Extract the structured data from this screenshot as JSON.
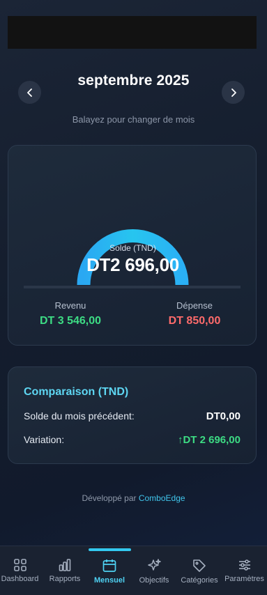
{
  "header": {
    "month": "septembre 2025",
    "hint": "Balayez pour changer de mois"
  },
  "balance_card": {
    "gauge_label": "Solde (TND)",
    "balance": "DT2 696,00",
    "gauge_fill_fraction": 1.0,
    "income_label": "Revenu",
    "income_value": "DT 3 546,00",
    "expense_label": "Dépense",
    "expense_value": "DT 850,00"
  },
  "comparison": {
    "title": "Comparaison (TND)",
    "previous_label": "Solde du mois précédent:",
    "previous_value": "DT0,00",
    "variation_label": "Variation:",
    "variation_value": "↑DT 2 696,00"
  },
  "footer": {
    "prefix": "Développé par",
    "brand": "ComboEdge"
  },
  "bottom_nav": {
    "active": "Mensuel",
    "items": [
      {
        "label": "Dashboard",
        "icon": "grid-icon"
      },
      {
        "label": "Rapports",
        "icon": "bar-chart-icon"
      },
      {
        "label": "Mensuel",
        "icon": "calendar-icon"
      },
      {
        "label": "Objectifs",
        "icon": "sparkles-icon"
      },
      {
        "label": "Catégories",
        "icon": "tag-icon"
      },
      {
        "label": "Paramètres",
        "icon": "sliders-icon"
      }
    ]
  },
  "colors": {
    "accent": "#33c8ef",
    "income": "#3ddc84",
    "expense": "#ff6b6b",
    "title_accent": "#5ed6f2"
  }
}
